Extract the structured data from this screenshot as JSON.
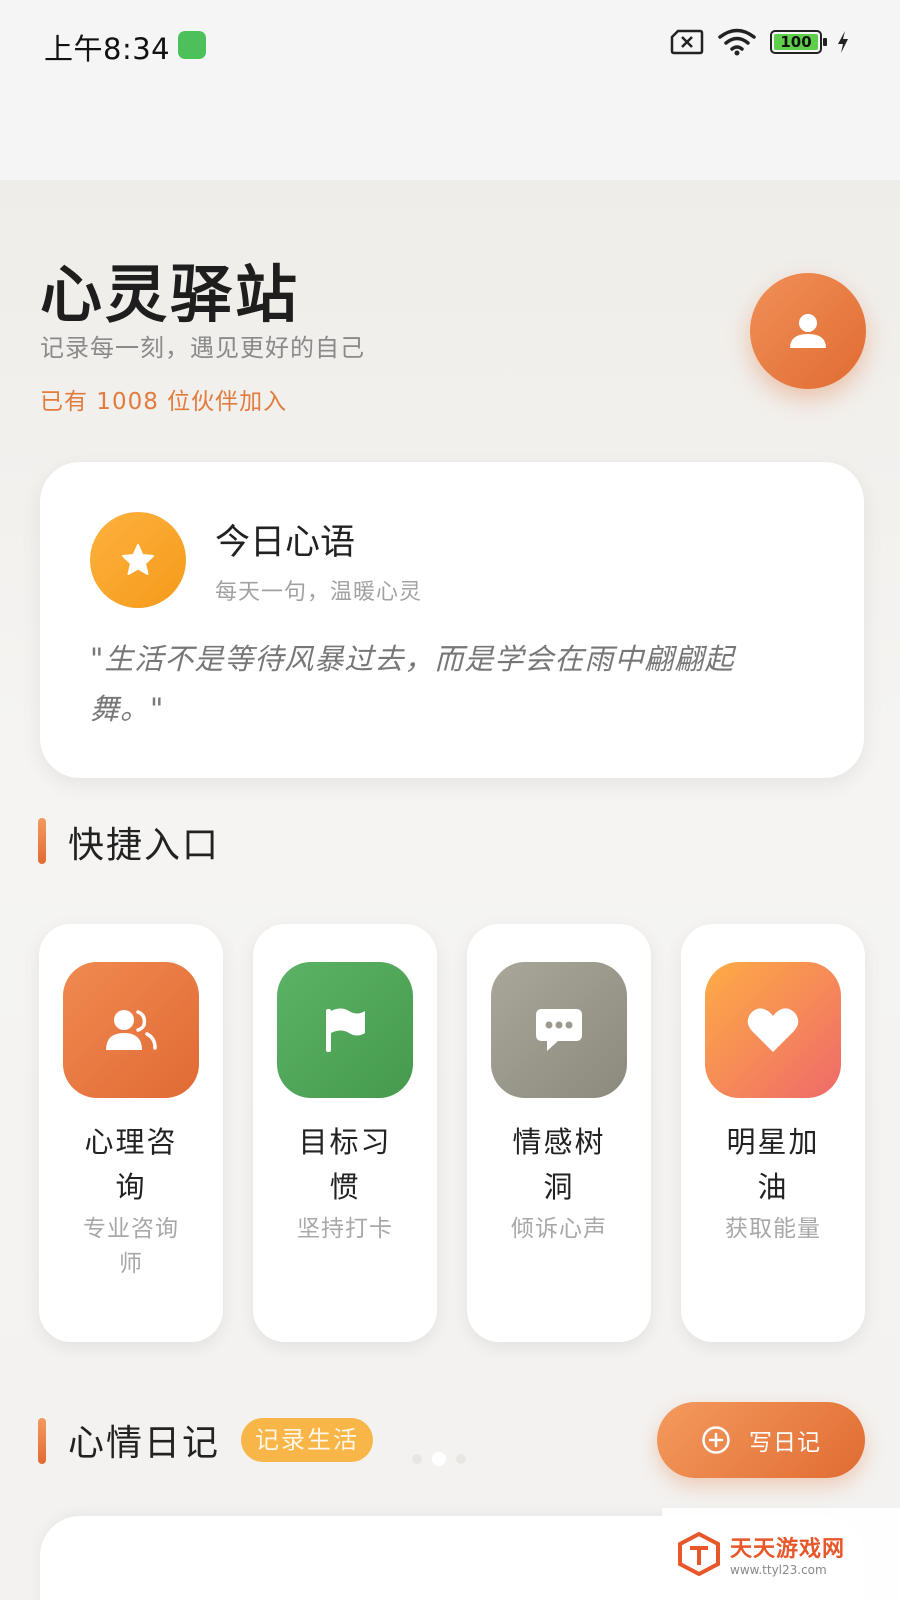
{
  "status_bar": {
    "time": "上午8:34",
    "battery": "100"
  },
  "header": {
    "title": "心灵驿站",
    "subtitle": "记录每一刻，遇见更好的自己",
    "members": "已有 1008 位伙伴加入"
  },
  "daily_quote": {
    "title": "今日心语",
    "subtitle": "每天一句，温暖心灵",
    "text": "\"生活不是等待风暴过去，而是学会在雨中翩翩起舞。\""
  },
  "quick_section": {
    "title": "快捷入口"
  },
  "quick_items": [
    {
      "title": "心理咨询",
      "subtitle": "专业咨询师",
      "icon": "users-icon",
      "color": "#e8753e"
    },
    {
      "title": "目标习惯",
      "subtitle": "坚持打卡",
      "icon": "flag-icon",
      "color": "#52a55a"
    },
    {
      "title": "情感树洞",
      "subtitle": "倾诉心声",
      "icon": "chat-bubble-icon",
      "color": "#9c9a8c"
    },
    {
      "title": "明星加油",
      "subtitle": "获取能量",
      "icon": "heart-icon",
      "color": "#f5905a"
    }
  ],
  "diary_section": {
    "title": "心情日记",
    "tag": "记录生活",
    "write_button": "写日记"
  },
  "watermark": {
    "name": "天天游戏网",
    "url": "www.ttyl23.com"
  }
}
